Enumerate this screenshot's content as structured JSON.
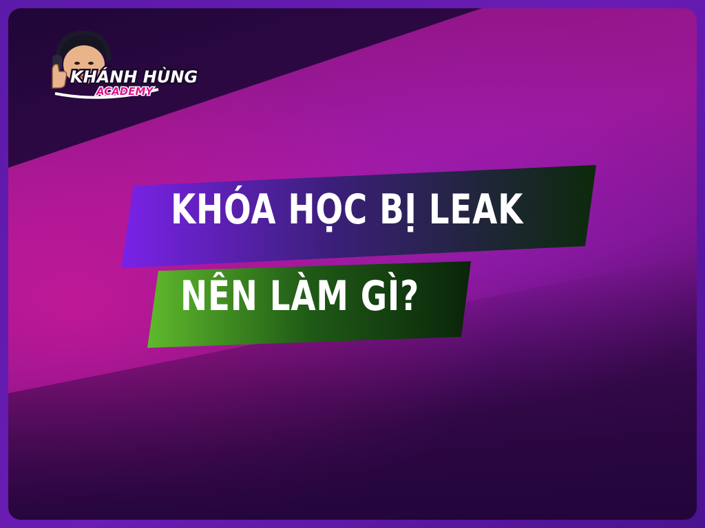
{
  "colors": {
    "frame": "#5b1aa8",
    "background_magenta": "#9a1898",
    "background_dark": "#2a0640",
    "banner1_start": "#7a22e8",
    "banner1_end": "#0c2a0a",
    "banner2_start": "#5fba2c",
    "banner2_end": "#0a240a",
    "text": "#ffffff",
    "logo_pink": "#e0148c"
  },
  "logo": {
    "name_line": "KHÁNH HÙNG",
    "sub_line": "ACADEMY",
    "mascot_icon": "thumbs-up-mascot-icon"
  },
  "headline": {
    "line1": "KHÓA HỌC BỊ LEAK",
    "line2": "NÊN LÀM GÌ?"
  }
}
